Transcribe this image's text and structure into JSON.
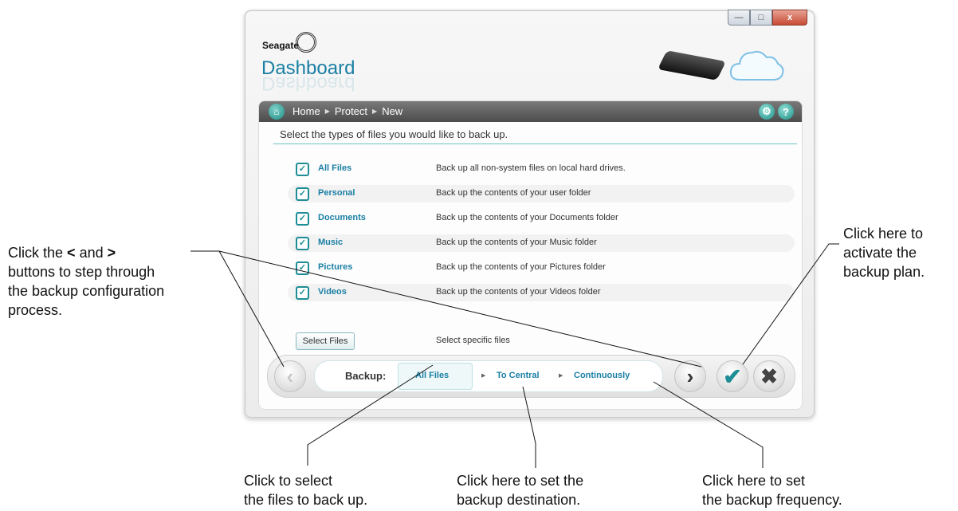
{
  "window": {
    "controls": [
      "minimize-icon",
      "restore-icon",
      "close-icon"
    ],
    "brand": "Seagate",
    "app_title": "Dashboard"
  },
  "breadcrumb": [
    "Home",
    "Protect",
    "New"
  ],
  "header_icons": [
    "gear-icon",
    "help-icon"
  ],
  "prompt": "Select the types of files you would like to back up.",
  "file_types": [
    {
      "label": "All Files",
      "desc": "Back up all non-system files on local hard drives.",
      "checked": true
    },
    {
      "label": "Personal",
      "desc": "Back up the contents of your user folder",
      "checked": true
    },
    {
      "label": "Documents",
      "desc": "Back up the contents of your Documents folder",
      "checked": true
    },
    {
      "label": "Music",
      "desc": "Back up the contents of your Music folder",
      "checked": true
    },
    {
      "label": "Pictures",
      "desc": "Back up the contents of your Pictures folder",
      "checked": true
    },
    {
      "label": "Videos",
      "desc": "Back up the contents of your Videos folder",
      "checked": true
    }
  ],
  "select_files": {
    "button": "Select Files",
    "desc": "Select specific files"
  },
  "bottom_bar": {
    "label": "Backup:",
    "steps": [
      "All Files",
      "To Central",
      "Continuously"
    ],
    "selected_step": "All Files"
  },
  "callouts": {
    "nav": [
      "Click the",
      "<",
      "and",
      ">",
      "buttons to step through",
      "the backup configuration",
      "process."
    ],
    "activate": [
      "Click here to",
      "activate the",
      "backup plan."
    ],
    "select": [
      "Click to select",
      "the files to back up."
    ],
    "destination": [
      "Click here to set the",
      "backup destination."
    ],
    "frequency": [
      "Click here to set",
      "the backup frequency."
    ]
  },
  "colors": {
    "accent": "#1a7fa4",
    "teal": "#1f8d96",
    "header": "#5a5a5a"
  }
}
